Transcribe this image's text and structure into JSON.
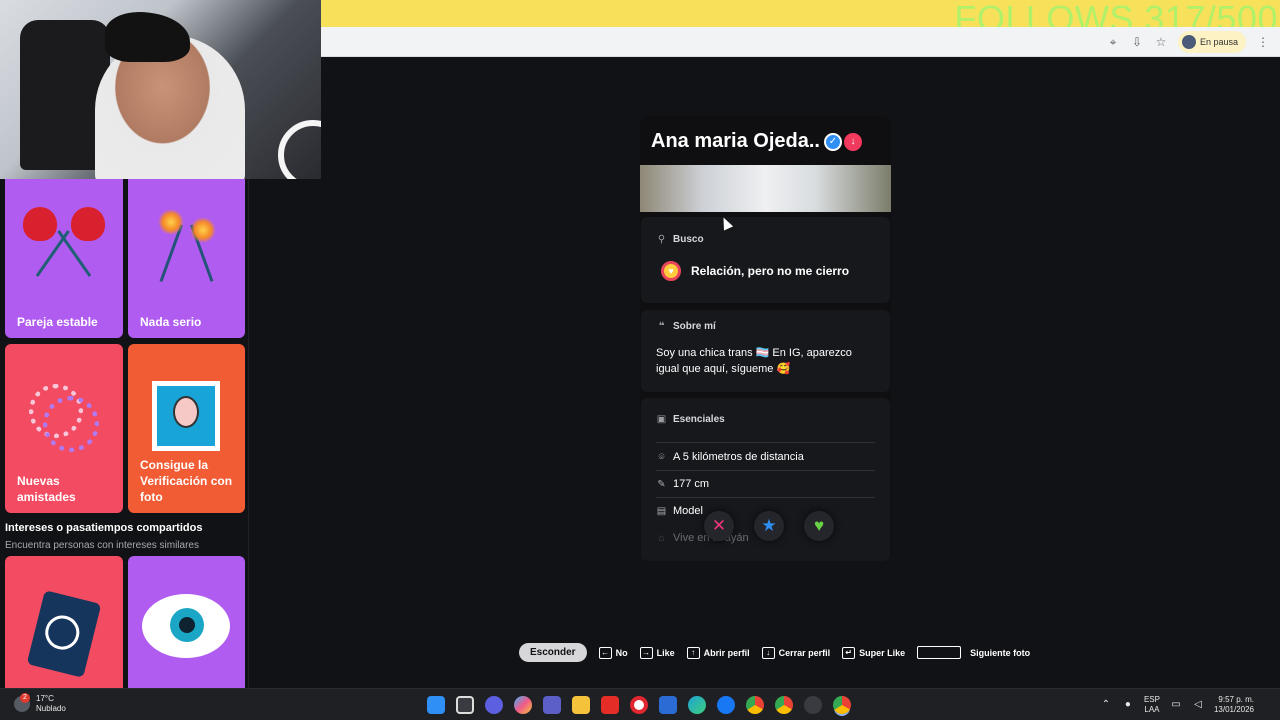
{
  "overlay": {
    "follows": "FOLLOWS 317/500"
  },
  "browser": {
    "pause_label": "En pausa"
  },
  "left_panel": {
    "cards": [
      {
        "label": "Pareja estable"
      },
      {
        "label": "Nada serio"
      },
      {
        "label": "Nuevas amistades"
      },
      {
        "label": "Consigue la Verificación con foto"
      }
    ],
    "section_title": "Intereses o pasatiempos compartidos",
    "section_subtitle": "Encuentra personas con intereses similares"
  },
  "profile": {
    "name": "Ana maria Ojeda..",
    "busco_title": "Busco",
    "busco_value": "Relación, pero no me cierro",
    "sobre_title": "Sobre mí",
    "sobre_text": "Soy una chica trans 🏳️‍⚧️ En IG, aparezco igual que aquí, sígueme 🥰",
    "esenciales_title": "Esenciales",
    "essentials": [
      {
        "icon": "location-pin-icon",
        "text": "A 5 kilómetros de distancia"
      },
      {
        "icon": "ruler-icon",
        "text": "177 cm"
      },
      {
        "icon": "briefcase-icon",
        "text": "Model"
      },
      {
        "icon": "home-icon",
        "text": "Vive en ... ayán"
      }
    ]
  },
  "shortcuts": {
    "hide": "Esconder",
    "no": "No",
    "like": "Like",
    "open_profile": "Abrir perfil",
    "close_profile": "Cerrar perfil",
    "super_like": "Super Like",
    "next_photo": "Siguiente foto"
  },
  "taskbar": {
    "weather_badge": "2",
    "temperature": "17°C",
    "condition": "Nublado",
    "lang_top": "ESP",
    "lang_bottom": "LAA",
    "time": "9:57 p. m.",
    "date": "13/01/2026"
  }
}
